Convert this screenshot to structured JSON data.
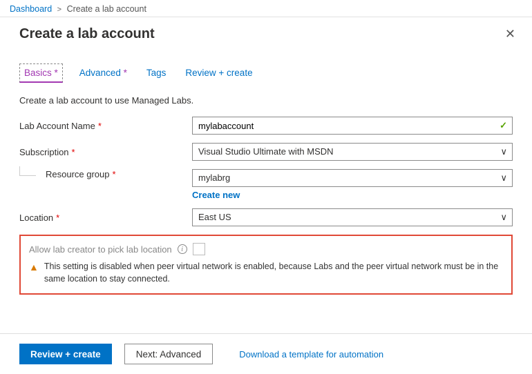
{
  "breadcrumb": {
    "root": "Dashboard",
    "current": "Create a lab account"
  },
  "header": {
    "title": "Create a lab account"
  },
  "tabs": {
    "basics": "Basics",
    "advanced": "Advanced",
    "tags": "Tags",
    "review": "Review + create",
    "required_marker": "*"
  },
  "intro": "Create a lab account to use Managed Labs.",
  "fields": {
    "labAccountName": {
      "label": "Lab Account Name",
      "value": "mylabaccount"
    },
    "subscription": {
      "label": "Subscription",
      "value": "Visual Studio Ultimate with MSDN"
    },
    "resourceGroup": {
      "label": "Resource group",
      "value": "mylabrg",
      "createNew": "Create new"
    },
    "location": {
      "label": "Location",
      "value": "East US"
    }
  },
  "allowPick": {
    "label": "Allow lab creator to pick lab location",
    "warning": "This setting is disabled when peer virtual network is enabled, because Labs and the peer virtual network must be in the same location to stay connected."
  },
  "footer": {
    "review": "Review + create",
    "next": "Next: Advanced",
    "download": "Download a template for automation"
  }
}
